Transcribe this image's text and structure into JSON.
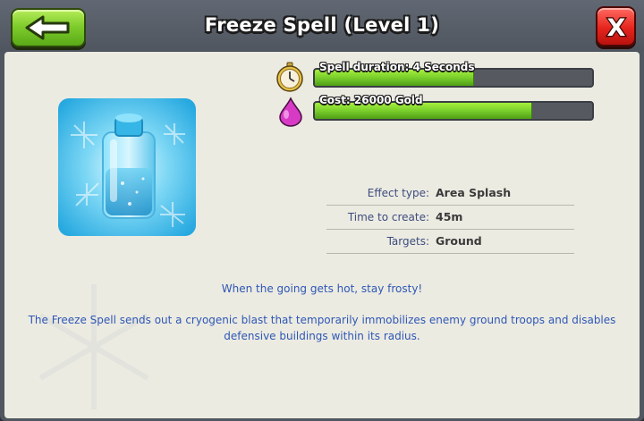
{
  "window": {
    "title": "Freeze Spell (Level 1)",
    "back_icon": "arrow-left-icon",
    "close_label": "X",
    "close_icon": "close-icon"
  },
  "stats": [
    {
      "label": "Spell duration: 4 Seconds",
      "icon": "stopwatch-icon",
      "fill_fraction": 0.57
    },
    {
      "label": "Cost: 26000 Gold",
      "icon": "elixir-drop-icon",
      "fill_fraction": 0.78
    }
  ],
  "info": [
    {
      "key": "Effect type:",
      "value": "Area Splash"
    },
    {
      "key": "Time to create:",
      "value": "45m"
    },
    {
      "key": "Targets:",
      "value": "Ground"
    }
  ],
  "tagline": "When the going gets hot, stay frosty!",
  "description": "The Freeze Spell sends out a cryogenic blast that temporarily immobilizes enemy ground troops and disables defensive buildings within its radius.",
  "colors": {
    "accent_green": "#7bd02c",
    "close_red": "#e5251d",
    "text_blue": "#2e57b5",
    "elixir_pink": "#d73ac4"
  }
}
